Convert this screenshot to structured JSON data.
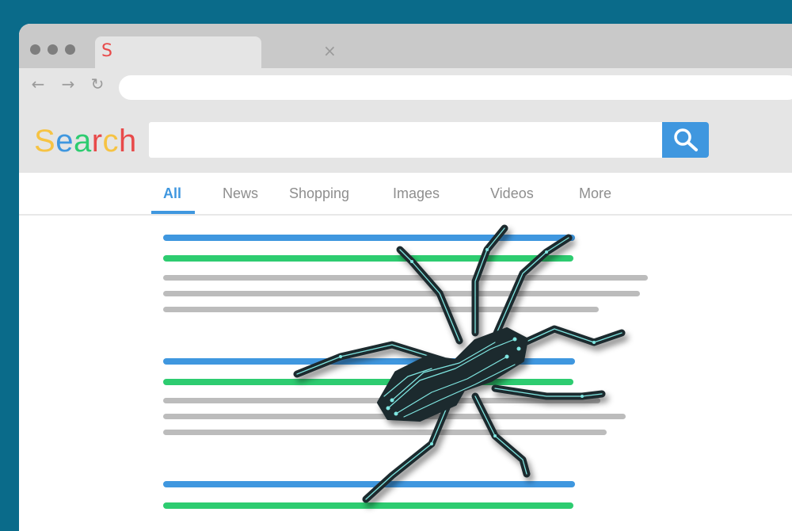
{
  "browser": {
    "tab": {
      "favicon_letter": "S",
      "close_glyph": "×"
    },
    "nav": {
      "back": "←",
      "forward": "→",
      "reload": "↻"
    },
    "url": {
      "value": ""
    }
  },
  "search": {
    "logo_letters": [
      {
        "char": "S",
        "color": "#f6c343"
      },
      {
        "char": "e",
        "color": "#3f97df"
      },
      {
        "char": "a",
        "color": "#2dcc70"
      },
      {
        "char": "r",
        "color": "#e84a4a"
      },
      {
        "char": "c",
        "color": "#f6c343"
      },
      {
        "char": "h",
        "color": "#e84a4a"
      }
    ],
    "query": "",
    "button_icon": "search-icon"
  },
  "tabs": [
    {
      "label": "All",
      "active": true
    },
    {
      "label": "News",
      "active": false
    },
    {
      "label": "Shopping",
      "active": false
    },
    {
      "label": "Images",
      "active": false
    },
    {
      "label": "Videos",
      "active": false
    },
    {
      "label": "More",
      "active": false
    }
  ],
  "colors": {
    "accent_blue": "#3f97df",
    "accent_green": "#2dcc70",
    "placeholder_gray": "#bcbcbc",
    "background": "#0a6b8a"
  },
  "illustration": {
    "subject": "spider-icon"
  }
}
